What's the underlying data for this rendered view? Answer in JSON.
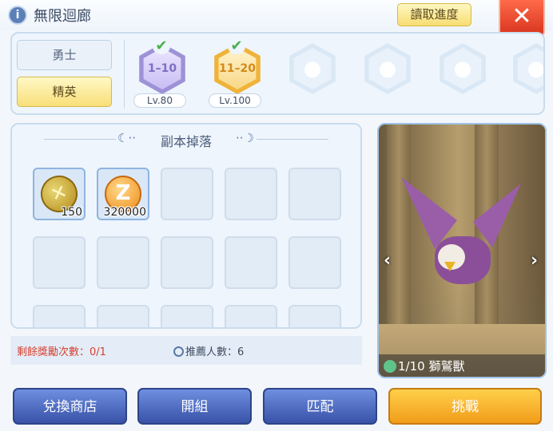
{
  "window": {
    "title": "無限迴廊",
    "read_progress_label": "讀取進度",
    "close_glyph": "✕",
    "info_glyph": "i"
  },
  "difficulty": {
    "warrior_label": "勇士",
    "elite_label": "精英",
    "selected": "精英"
  },
  "stages": [
    {
      "range": "1–10",
      "level": "Lv.80",
      "status": "cleared",
      "check_glyph": "✔"
    },
    {
      "range": "11–20",
      "level": "Lv.100",
      "status": "cleared",
      "check_glyph": "✔"
    },
    {
      "status": "locked",
      "icon": "poring-icon"
    },
    {
      "status": "locked",
      "icon": "poring-icon"
    },
    {
      "status": "locked",
      "icon": "poring-icon"
    },
    {
      "status": "locked",
      "icon": "poring-icon"
    }
  ],
  "drops": {
    "title": "副本掉落",
    "items": [
      {
        "name": "x-coin",
        "qty": "150",
        "glyph": "✕"
      },
      {
        "name": "zeny-coin",
        "qty": "320000",
        "glyph": "Z"
      }
    ]
  },
  "remaining": {
    "label": "剩餘獎勵次數：0/1",
    "recommend": "推薦人數：6"
  },
  "boss": {
    "name_label": "1/10 獅鷲獸"
  },
  "buttons": {
    "exchange_shop": "兌換商店",
    "open_party": "開組",
    "match": "匹配",
    "challenge": "挑戰"
  },
  "colors": {
    "accent_blue": "#3852a8",
    "challenge_orange": "#f19c1a",
    "close_red": "#d8341e",
    "warning_red": "#d7402f"
  }
}
